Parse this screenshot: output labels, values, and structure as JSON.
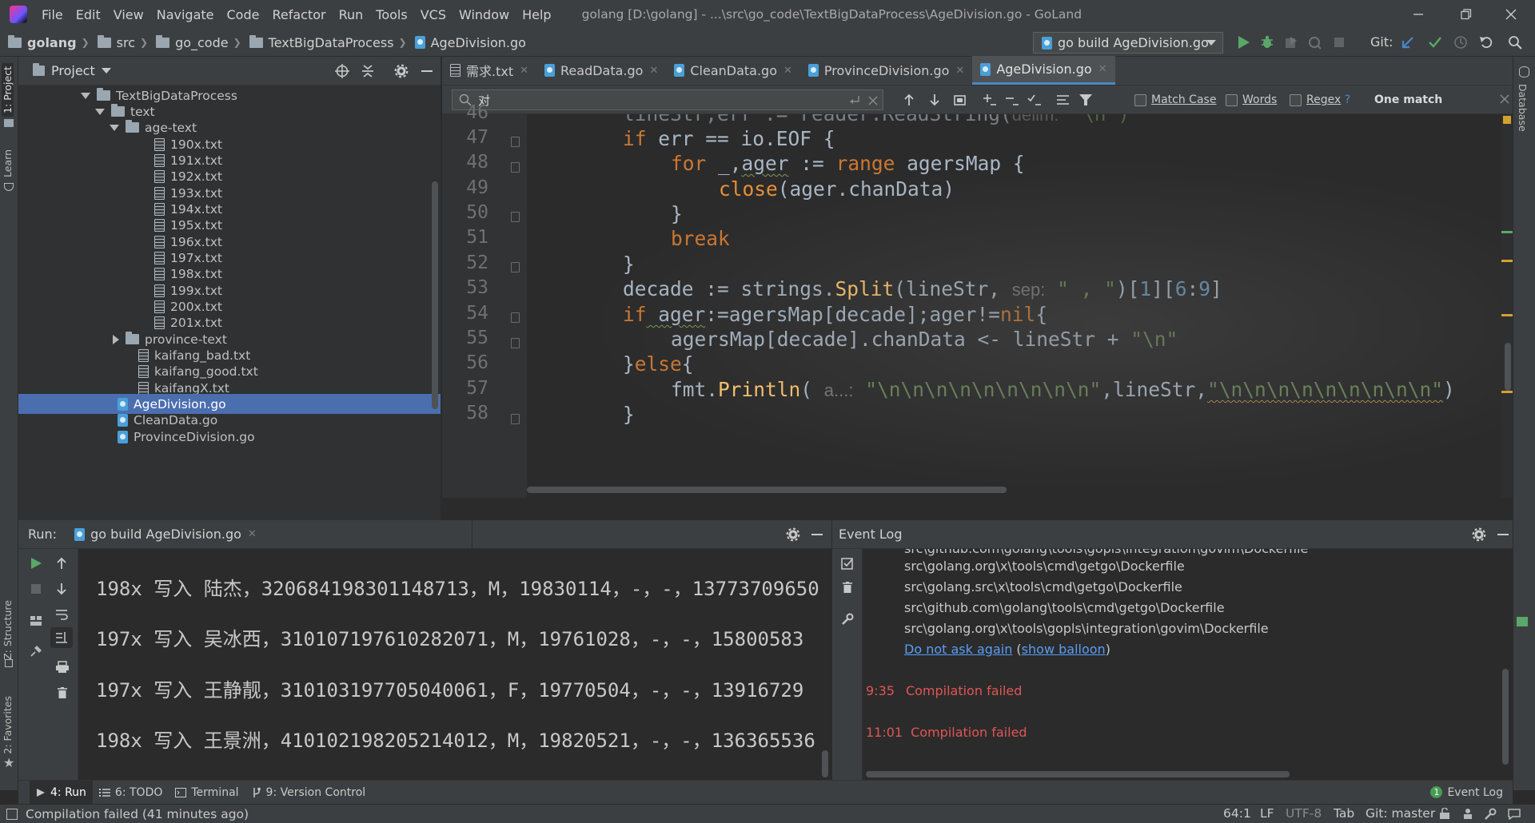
{
  "window": {
    "title": "golang [D:\\golang] - ...\\src\\go_code\\TextBigDataProcess\\AgeDivision.go - GoLand",
    "menu": [
      "File",
      "Edit",
      "View",
      "Navigate",
      "Code",
      "Refactor",
      "Run",
      "Tools",
      "VCS",
      "Window",
      "Help"
    ]
  },
  "breadcrumb": [
    "golang",
    "src",
    "go_code",
    "TextBigDataProcess",
    "AgeDivision.go"
  ],
  "run_config": "go build AgeDivision.go",
  "git_label": "Git:",
  "sidebar_left": {
    "project_tab": "1: Project",
    "learn_tab": "Learn",
    "structure_tab": "Z: Structure",
    "favorites_tab": "2: Favorites"
  },
  "sidebar_right": {
    "database_tab": "Database"
  },
  "project": {
    "header": "Project",
    "tree": [
      {
        "label": "TextBigDataProcess",
        "type": "folder",
        "arrow": "down",
        "indent": 78
      },
      {
        "label": "text",
        "type": "folder",
        "arrow": "down",
        "indent": 96
      },
      {
        "label": "age-text",
        "type": "folder",
        "arrow": "down",
        "indent": 114
      },
      {
        "label": "190x.txt",
        "type": "txt",
        "indent": 156
      },
      {
        "label": "191x.txt",
        "type": "txt",
        "indent": 156
      },
      {
        "label": "192x.txt",
        "type": "txt",
        "indent": 156
      },
      {
        "label": "193x.txt",
        "type": "txt",
        "indent": 156
      },
      {
        "label": "194x.txt",
        "type": "txt",
        "indent": 156
      },
      {
        "label": "195x.txt",
        "type": "txt",
        "indent": 156
      },
      {
        "label": "196x.txt",
        "type": "txt",
        "indent": 156
      },
      {
        "label": "197x.txt",
        "type": "txt",
        "indent": 156
      },
      {
        "label": "198x.txt",
        "type": "txt",
        "indent": 156
      },
      {
        "label": "199x.txt",
        "type": "txt",
        "indent": 156
      },
      {
        "label": "200x.txt",
        "type": "txt",
        "indent": 156
      },
      {
        "label": "201x.txt",
        "type": "txt",
        "indent": 156
      },
      {
        "label": "province-text",
        "type": "folder",
        "arrow": "right",
        "indent": 114
      },
      {
        "label": "kaifang_bad.txt",
        "type": "txt",
        "indent": 136
      },
      {
        "label": "kaifang_good.txt",
        "type": "txt",
        "indent": 136
      },
      {
        "label": "kaifangX.txt",
        "type": "txt",
        "indent": 136
      },
      {
        "label": "AgeDivision.go",
        "type": "go",
        "indent": 118,
        "selected": true
      },
      {
        "label": "CleanData.go",
        "type": "go",
        "indent": 118
      },
      {
        "label": "ProvinceDivision.go",
        "type": "go",
        "indent": 118
      }
    ]
  },
  "editor": {
    "tabs": [
      {
        "label": "需求.txt",
        "type": "txt"
      },
      {
        "label": "ReadData.go",
        "type": "go"
      },
      {
        "label": "CleanData.go",
        "type": "go"
      },
      {
        "label": "ProvinceDivision.go",
        "type": "go"
      },
      {
        "label": "AgeDivision.go",
        "type": "go",
        "active": true
      }
    ],
    "search": {
      "query": "对",
      "match_case": "Match Case",
      "words": "Words",
      "regex": "Regex",
      "help": "?",
      "result": "One match"
    },
    "line_numbers": [
      "46",
      "47",
      "48",
      "49",
      "50",
      "51",
      "52",
      "53",
      "54",
      "55",
      "56",
      "57",
      "58"
    ],
    "code": {
      "l46_a": "lineStr,err := reader.ReadString(",
      "l46_hint": "delim:",
      "l46_b": " '\\n')",
      "l47_kw": "if",
      "l47_rest": " err == io.EOF {",
      "l48_kw": "for",
      "l48_a": " _,",
      "l48_var": "ager",
      "l48_b": " := ",
      "l48_kw2": "range",
      "l48_c": " agersMap {",
      "l49_fn": "close",
      "l49_rest": "(ager.chanData)",
      "l50": "}",
      "l51_kw": "break",
      "l52": "}",
      "l53_a": "decade := strings.",
      "l53_fn": "Split",
      "l53_b": "(lineStr, ",
      "l53_hint": "sep:",
      "l53_str": " \" , \"",
      "l53_c": ")[",
      "l53_n1": "1",
      "l53_d": "][",
      "l53_n2": "6",
      "l53_e": ":",
      "l53_n3": "9",
      "l53_f": "]",
      "l54_kw": "if",
      "l54_var": " ager",
      "l54_a": ":=agersMap[decade];ager!=",
      "l54_kw2": "nil",
      "l54_b": "{",
      "l55_a": "agersMap[decade].chanData <- lineStr + ",
      "l55_str": "\"\\n\"",
      "l56_a": "}",
      "l56_kw": "else",
      "l56_b": "{",
      "l57_a": "fmt.",
      "l57_fn": "Println",
      "l57_b": "( ",
      "l57_hint": "a...:",
      "l57_str1": " \"\\n\\n\\n\\n\\n\\n\\n\\n\\n\"",
      "l57_c": ",lineStr,",
      "l57_str2": "\"\\n\\n\\n\\n\\n\\n\\n\\n\\n\"",
      "l57_d": ")",
      "l58": "}"
    }
  },
  "run": {
    "label": "Run:",
    "tab": "go build AgeDivision.go",
    "output": [
      "198x 写入 陆杰，320684198301148713，M，19830114，-，-，13773709650",
      "197x 写入 吴冰西，310107197610282071，M，19761028，-，-，15800583",
      "197x 写入 王静靓，310103197705040061，F，19770504，-，-，13916729",
      "198x 写入 王景洲，410102198205214012，M，19820521，-，-，136365536"
    ]
  },
  "event_log": {
    "title": "Event Log",
    "lines": [
      "src\\github.com\\golang\\tools\\gopls\\integration\\govim\\Dockerfile",
      "src\\golang.org\\x\\tools\\cmd\\getgo\\Dockerfile",
      "src\\golang.src\\x\\tools\\cmd\\getgo\\Dockerfile",
      "src\\github.com\\golang\\tools\\cmd\\getgo\\Dockerfile",
      "src\\golang.org\\x\\tools\\gopls\\integration\\govim\\Dockerfile"
    ],
    "link_dont_ask": "Do not ask again",
    "link_paren_open": "(",
    "link_show_balloon": "show balloon",
    "link_paren_close": ")",
    "entries": [
      {
        "time": "9:35",
        "text": "Compilation failed"
      },
      {
        "time": "11:01",
        "text": "Compilation failed"
      }
    ]
  },
  "toolwindows": {
    "run": "4: Run",
    "todo": "6: TODO",
    "terminal": "Terminal",
    "vcs": "9: Version Control",
    "event_log_count": "1",
    "event_log": "Event Log"
  },
  "status": {
    "message": "Compilation failed (41 minutes ago)",
    "position": "64:1",
    "line_sep": "LF",
    "encoding": "UTF-8",
    "indent": "Tab",
    "branch": "Git: master"
  },
  "colors": {
    "accent": "#4a88c7",
    "selection": "#4b6eaf",
    "keyword": "#cc7832",
    "function": "#ffc66d",
    "string": "#6a8759",
    "number": "#6897bb",
    "error": "#e05555"
  }
}
